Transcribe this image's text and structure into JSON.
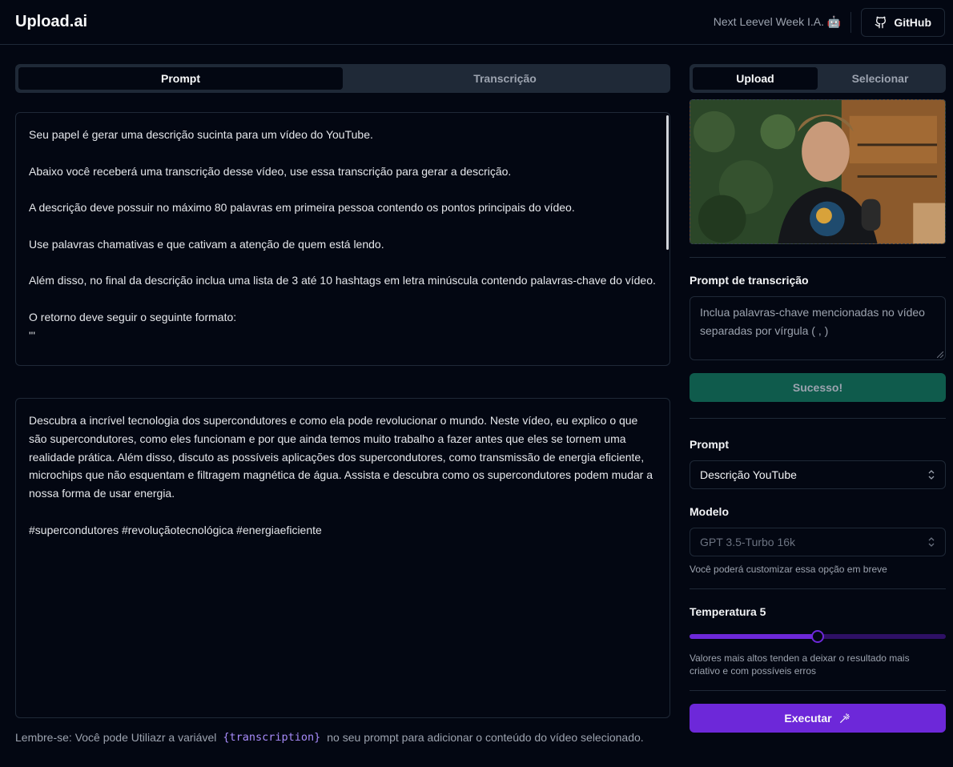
{
  "header": {
    "logo": "Upload.ai",
    "event_text": "Next Leevel Week I.A. 🤖",
    "github_label": "GitHub"
  },
  "left_tabs": [
    {
      "label": "Prompt",
      "active": true
    },
    {
      "label": "Transcrição",
      "active": false
    }
  ],
  "prompt_text": "Seu papel é gerar uma descrição sucinta para um vídeo do YouTube.\n\nAbaixo você receberá uma transcrição desse vídeo, use essa transcrição para gerar a descrição.\n\nA descrição deve possuir no máximo 80 palavras em primeira pessoa contendo os pontos principais do vídeo.\n\nUse palavras chamativas e que cativam a atenção de quem está lendo.\n\nAlém disso, no final da descrição inclua uma lista de 3 até 10 hashtags em letra minúscula contendo palavras-chave do vídeo.\n\nO retorno deve seguir o seguinte formato:\n'''",
  "result_text": "Descubra a incrível tecnologia dos supercondutores e como ela pode revolucionar o mundo. Neste vídeo, eu explico o que são supercondutores, como eles funcionam e por que ainda temos muito trabalho a fazer antes que eles se tornem uma realidade prática. Além disso, discuto as possíveis aplicações dos supercondutores, como transmissão de energia eficiente, microchips que não esquentam e filtragem magnética de água. Assista e descubra como os supercondutores podem mudar a nossa forma de usar energia.\n\n#supercondutores #revoluçãotecnológica #energiaeficiente",
  "hint": {
    "before": "Lembre-se: Você pode Utiliazr a variável",
    "code": "{transcription}",
    "after": "no seu prompt para adicionar o conteúdo do vídeo selecionado."
  },
  "right_tabs": [
    {
      "label": "Upload",
      "active": true
    },
    {
      "label": "Selecionar",
      "active": false
    }
  ],
  "transcription_prompt": {
    "label": "Prompt de transcrição",
    "placeholder": "Inclua palavras-chave mencionadas no vídeo separadas por vírgula ( , )"
  },
  "success_label": "Sucesso!",
  "prompt_select": {
    "label": "Prompt",
    "value": "Descrição YouTube"
  },
  "model_select": {
    "label": "Modelo",
    "value": "GPT 3.5-Turbo 16k",
    "help": "Você poderá customizar essa opção em breve"
  },
  "temperature": {
    "label": "Temperatura 5",
    "value_fraction": 0.5,
    "help": "Valores mais altos tenden a deixar o resultado mais criativo e com possíveis erros"
  },
  "execute_label": "Executar",
  "colors": {
    "background": "#030712",
    "border": "#1f2937",
    "accent": "#6d28d9",
    "success": "#0f5b4c"
  }
}
